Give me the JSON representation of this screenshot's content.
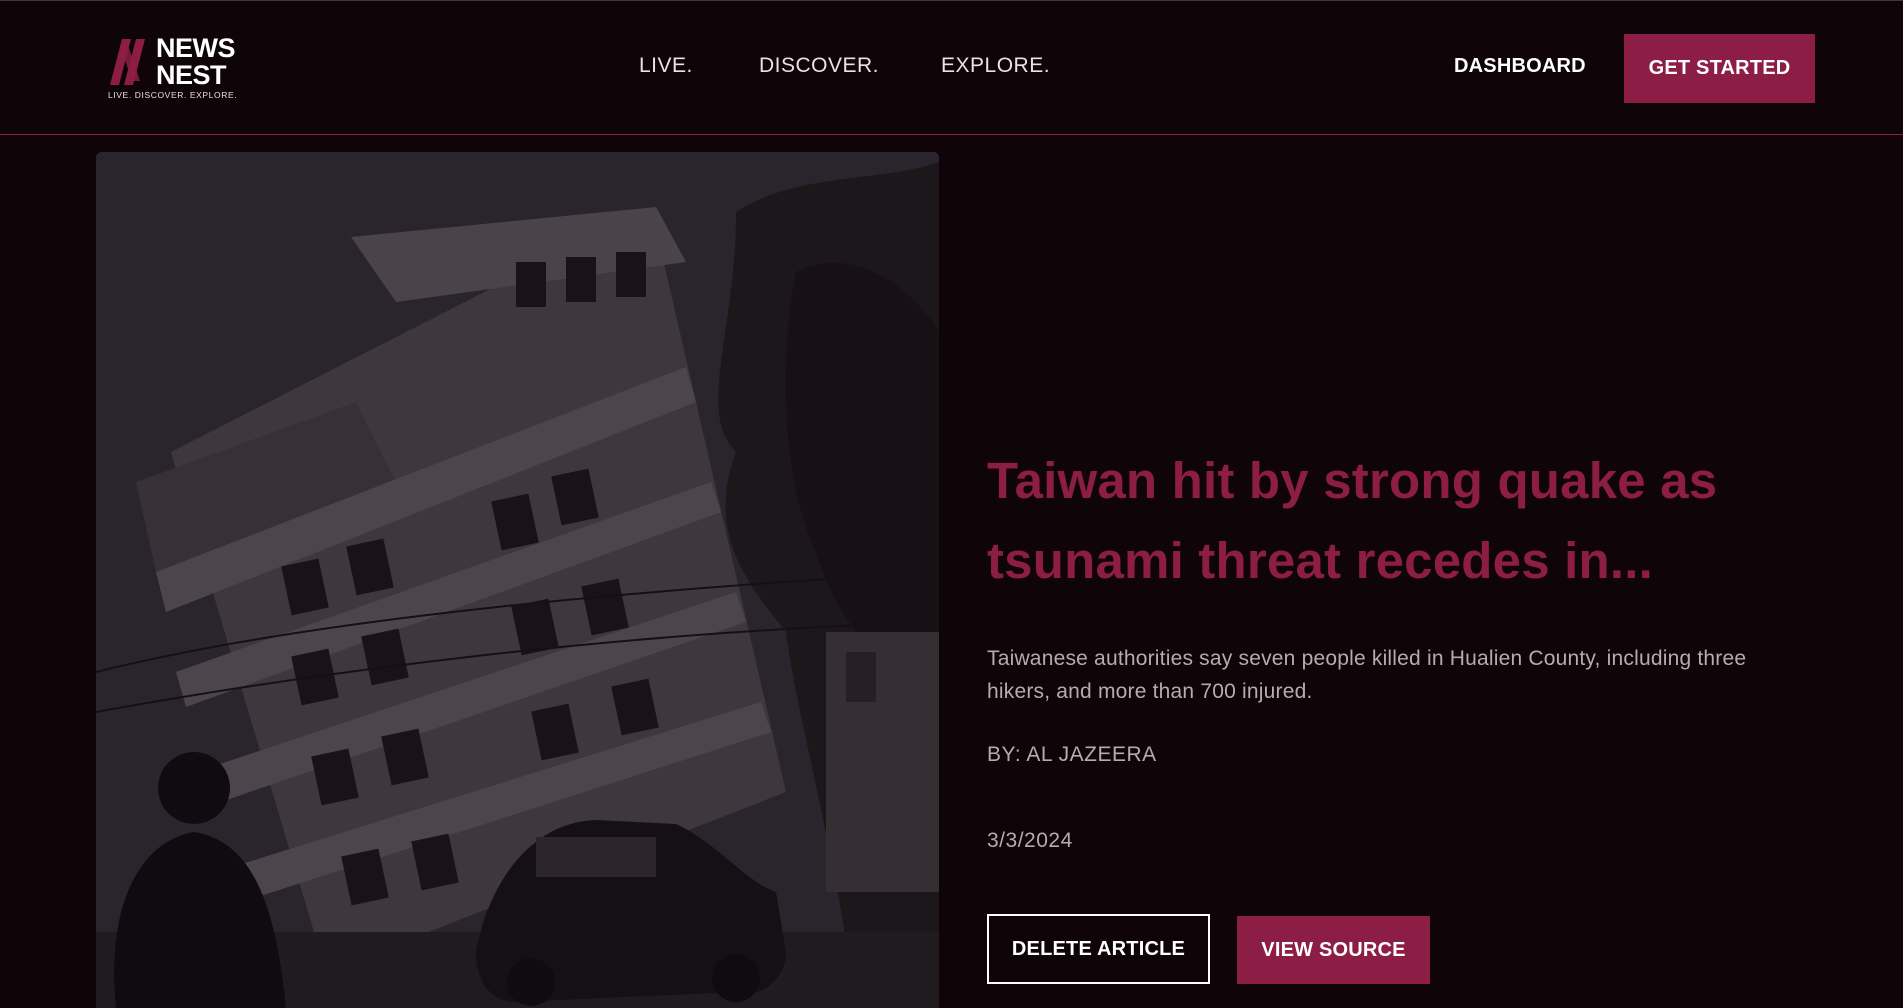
{
  "brand": {
    "word1": "NEWS",
    "word2": "NEST",
    "tagline": "LIVE.   DISCOVER.   EXPLORE.",
    "accent_color": "#8c1d45"
  },
  "nav": {
    "items": [
      {
        "label": "LIVE."
      },
      {
        "label": "DISCOVER."
      },
      {
        "label": "EXPLORE."
      }
    ]
  },
  "header_actions": {
    "dashboard_label": "DASHBOARD",
    "cta_label": "GET STARTED"
  },
  "article": {
    "image_icon": "collapsed-building-photo",
    "title": "Taiwan hit by strong quake as tsunami threat recedes in...",
    "description": "Taiwanese authorities say seven people killed in Hualien County, including three hikers, and more than 700 injured.",
    "byline": "BY: AL JAZEERA",
    "date": "3/3/2024",
    "delete_label": "DELETE ARTICLE",
    "source_label": "VIEW SOURCE"
  }
}
